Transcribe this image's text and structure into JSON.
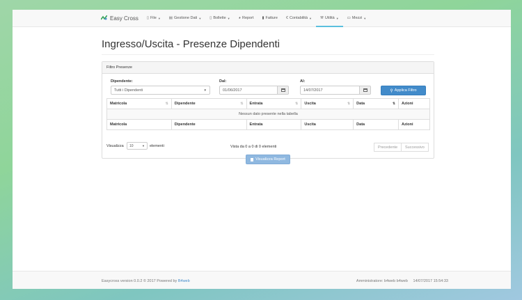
{
  "app": {
    "brand": "Easy Cross",
    "colors": {
      "primary": "#428bca",
      "active_tab": "#5bc0de",
      "disabled_button": "#8fb8e0"
    }
  },
  "nav": [
    {
      "label": "File",
      "icon": "file-icon",
      "caret": true
    },
    {
      "label": "Gestione Dati",
      "icon": "database-icon",
      "caret": true
    },
    {
      "label": "Bollette",
      "icon": "document-icon",
      "caret": true
    },
    {
      "label": "Report",
      "icon": "pie-chart-icon",
      "caret": false
    },
    {
      "label": "Fatture",
      "icon": "invoice-icon",
      "caret": false
    },
    {
      "label": "Contabilità",
      "icon": "euro-icon",
      "caret": true
    },
    {
      "label": "Utilità",
      "icon": "wrench-icon",
      "caret": true,
      "active": true
    },
    {
      "label": "Mezzi",
      "icon": "truck-icon",
      "caret": true
    }
  ],
  "page": {
    "title": "Ingresso/Uscita - Presenze Dipendenti"
  },
  "filter": {
    "panel_title": "Filtro Presenze",
    "dipendente_label": "Dipendente:",
    "dipendente_value": "Tutti i Dipendenti",
    "dal_label": "Dal:",
    "dal_value": "01/06/2017",
    "al_label": "Al:",
    "al_value": "14/07/2017",
    "apply_label": "Applica Filtro"
  },
  "table": {
    "columns": [
      "Matricola",
      "Dipendente",
      "Entrata",
      "Uscita",
      "Data",
      "Azioni"
    ],
    "empty_message": "Nessun dato presente nella tabella"
  },
  "datatable": {
    "length_prefix": "Visualizza",
    "length_value": "10",
    "length_suffix": "elementi",
    "info": "Vista da 0 a 0 di 0 elementi",
    "prev_label": "Precedente",
    "next_label": "Successivo"
  },
  "report_button": "Visualizza Report",
  "footer": {
    "version_text": "Easycross version 0.0.2 © 2017 Powered by",
    "powered_link": "B4web",
    "admin_text": "Amministratore: b4web b4web",
    "timestamp": "14/07/2017 15:54:33"
  }
}
